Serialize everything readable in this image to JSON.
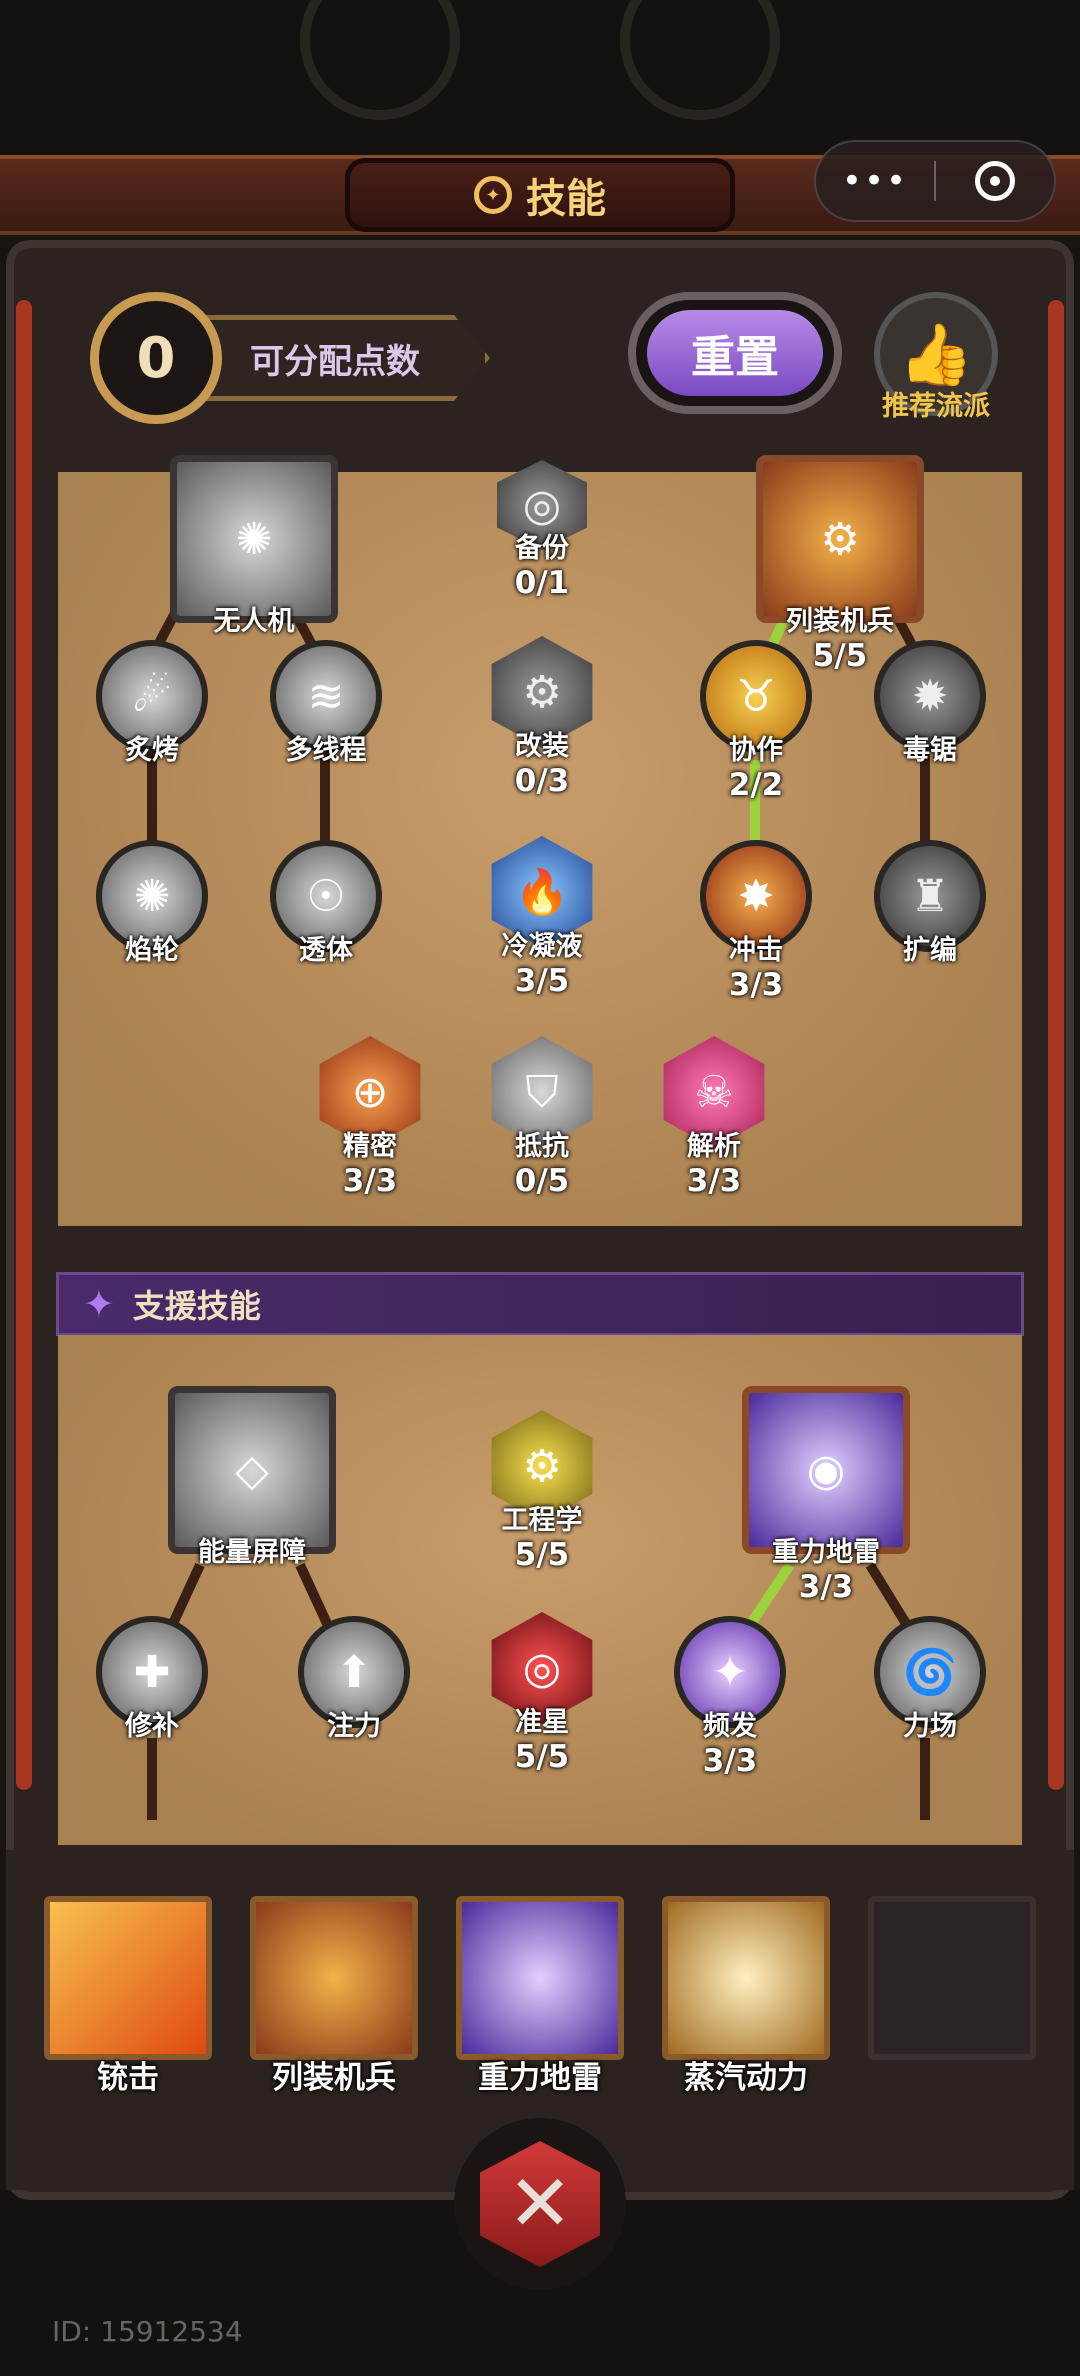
{
  "header": {
    "title": "技能",
    "points_value": "0",
    "points_label": "可分配点数",
    "reset_label": "重置",
    "recommend_label": "推荐流派",
    "capsule_more": "•••"
  },
  "tree1": {
    "nodes": [
      {
        "name": "无人机",
        "level": ""
      },
      {
        "name": "备份",
        "level": "0/1"
      },
      {
        "name": "列装机兵",
        "level": "5/5"
      },
      {
        "name": "炙烤",
        "level": ""
      },
      {
        "name": "多线程",
        "level": ""
      },
      {
        "name": "改装",
        "level": "0/3"
      },
      {
        "name": "协作",
        "level": "2/2"
      },
      {
        "name": "毒锯",
        "level": ""
      },
      {
        "name": "焰轮",
        "level": ""
      },
      {
        "name": "透体",
        "level": ""
      },
      {
        "name": "冷凝液",
        "level": "3/5"
      },
      {
        "name": "冲击",
        "level": "3/3"
      },
      {
        "name": "扩编",
        "level": ""
      },
      {
        "name": "精密",
        "level": "3/3"
      },
      {
        "name": "抵抗",
        "level": "0/5"
      },
      {
        "name": "解析",
        "level": "3/3"
      }
    ]
  },
  "support": {
    "header": "支援技能",
    "nodes": [
      {
        "name": "能量屏障",
        "level": ""
      },
      {
        "name": "工程学",
        "level": "5/5"
      },
      {
        "name": "重力地雷",
        "level": "3/3"
      },
      {
        "name": "修补",
        "level": ""
      },
      {
        "name": "注力",
        "level": ""
      },
      {
        "name": "准星",
        "level": "5/5"
      },
      {
        "name": "频发",
        "level": "3/3"
      },
      {
        "name": "力场",
        "level": ""
      }
    ]
  },
  "equipped": [
    {
      "label": "铳击"
    },
    {
      "label": "列装机兵"
    },
    {
      "label": "重力地雷"
    },
    {
      "label": "蒸汽动力"
    },
    {
      "label": ""
    }
  ],
  "footer": {
    "uid": "ID: 15912534"
  },
  "colors": {
    "gold": "#f6d27a",
    "purple": "#8a52d2",
    "active_link": "#9cd23a",
    "inactive_link": "#3a2014"
  }
}
